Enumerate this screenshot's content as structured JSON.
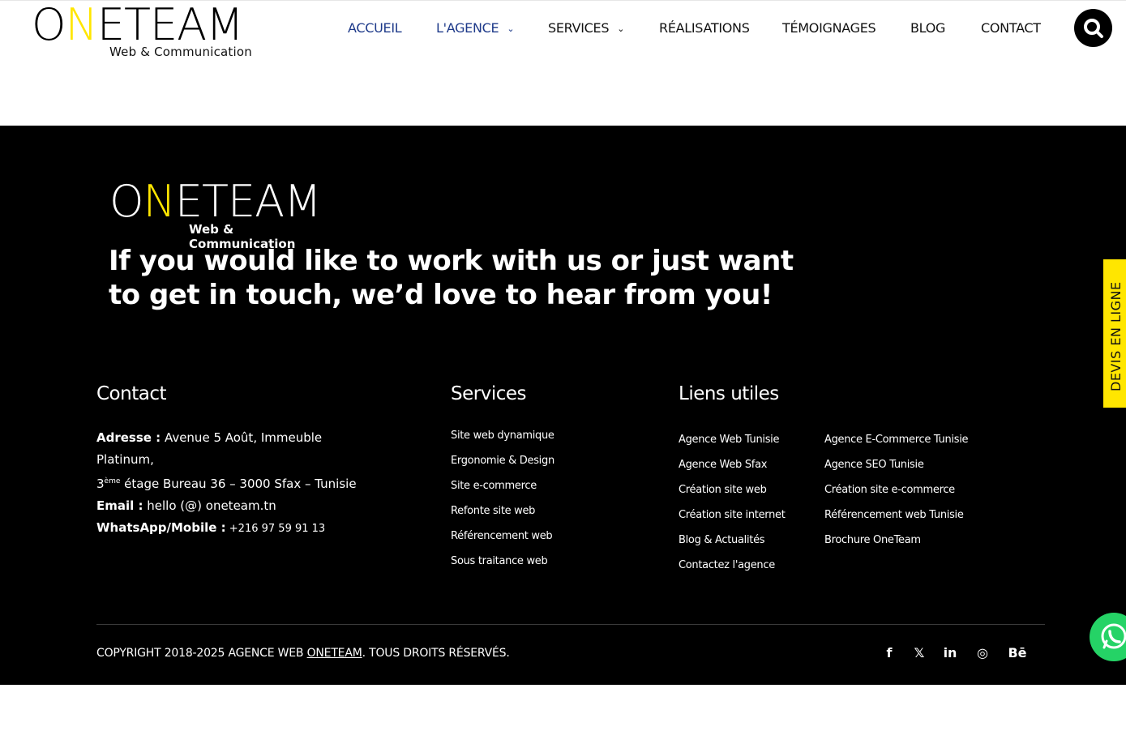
{
  "header": {
    "logo_main_left": "O",
    "logo_main_yellow": "N",
    "logo_main_right": "ETEAM",
    "logo_sub": "Web & Communication",
    "nav": [
      {
        "label": "ACCUEIL"
      },
      {
        "label": "L'AGENCE"
      },
      {
        "label": "SERVICES"
      },
      {
        "label": "RÉALISATIONS"
      },
      {
        "label": "TÉMOIGNAGES"
      },
      {
        "label": "BLOG"
      },
      {
        "label": "CONTACT"
      }
    ],
    "search_icon": "search-icon"
  },
  "footer": {
    "logo_main_left": "O",
    "logo_main_yellow": "N",
    "logo_main_right": "ETEAM",
    "logo_sub": "Web & Communication",
    "headline": "If you would like to work with us or just want to get in touch, we’d love to hear from you!",
    "contact": {
      "title": "Contact",
      "address_label": "Adresse :",
      "address_line1": " Avenue 5 Août, Immeuble Platinum,",
      "address_floor_num": "3",
      "address_floor_sup": "ème",
      "address_line2": " étage Bureau 36 – 3000 Sfax – Tunisie",
      "email_label": "Email :",
      "email_value": " hello (@) oneteam.tn",
      "whatsapp_label": "WhatsApp/Mobile :",
      "whatsapp_value": " +216 97 59 91 13"
    },
    "services": {
      "title": "Services",
      "items": [
        "Site web dynamique",
        "Ergonomie & Design",
        "Site e-commerce",
        "Refonte site web",
        "Référencement web",
        "Sous traitance web"
      ]
    },
    "liens": {
      "title": "Liens utiles",
      "col1": [
        "Agence Web Tunisie",
        "Agence Web Sfax",
        "Création site web",
        "Création site internet",
        "Blog & Actualités",
        "Contactez l'agence"
      ],
      "col2": [
        "Agence E-Commerce Tunisie",
        "Agence SEO Tunisie",
        "Création site e-commerce",
        "Référencement web Tunisie",
        "Brochure OneTeam"
      ]
    },
    "copyright_prefix": "COPYRIGHT 2018-2025 AGENCE WEB ",
    "copyright_brand": "ONETEAM",
    "copyright_suffix": ". TOUS DROITS RÉSERVÉS.",
    "socials": [
      {
        "icon": "facebook-icon",
        "glyph": "f"
      },
      {
        "icon": "x-twitter-icon",
        "glyph": "𝕏"
      },
      {
        "icon": "linkedin-icon",
        "glyph": "in"
      },
      {
        "icon": "instagram-icon",
        "glyph": "◎"
      },
      {
        "icon": "behance-icon",
        "glyph": "Bē"
      }
    ]
  },
  "devis_tab": "DEVIS EN LIGNE",
  "colors": {
    "accent_yellow": "#ffe600",
    "nav_active": "#1e3a8a",
    "whatsapp_green": "#25d366",
    "footer_bg": "#000000"
  }
}
